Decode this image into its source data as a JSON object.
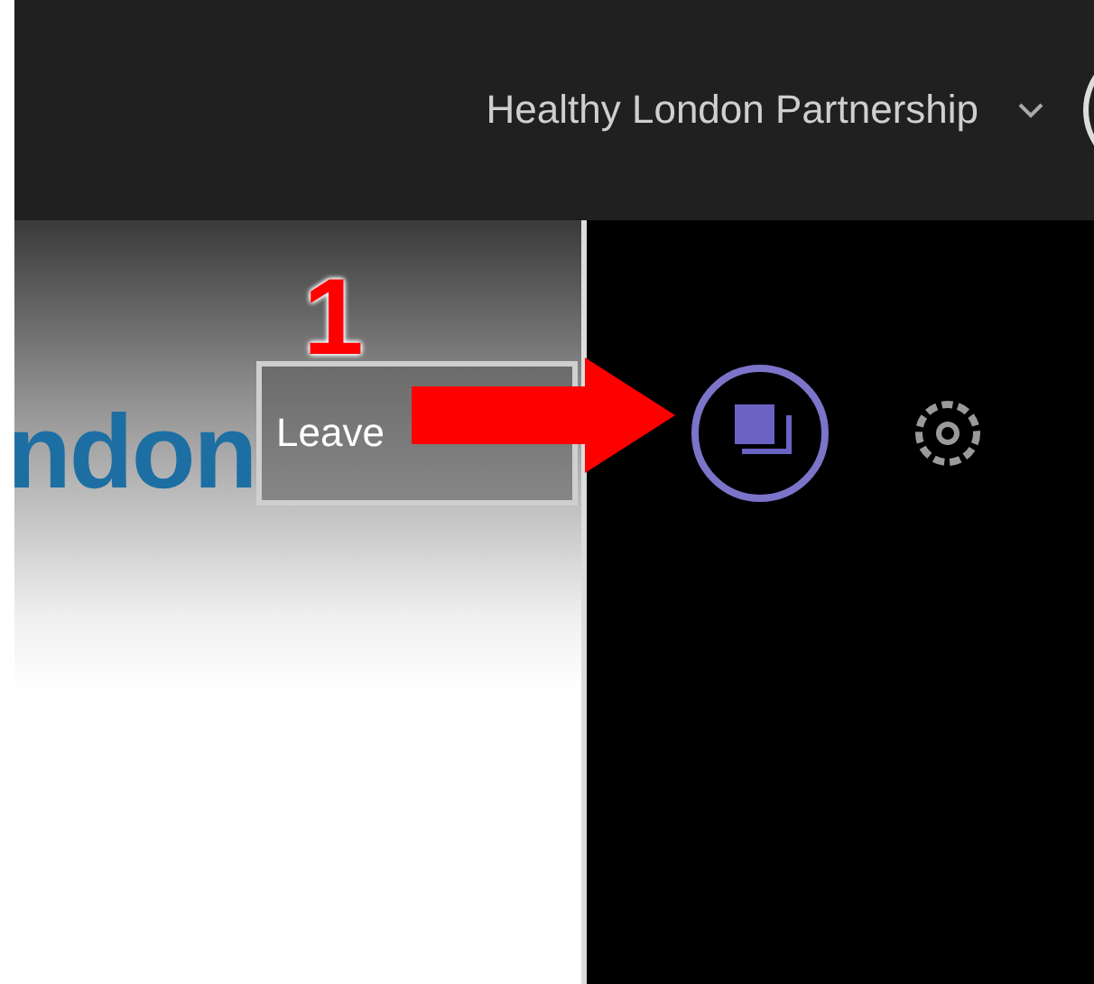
{
  "header": {
    "org_name": "Healthy London Partnership"
  },
  "stage": {
    "logo_text": "ndon",
    "leave_button": "Leave"
  },
  "toolbar": {
    "items": [
      {
        "kind": "chat",
        "selected": true
      },
      {
        "kind": "settings",
        "selected": false
      }
    ]
  },
  "annotation": {
    "number": "1"
  }
}
